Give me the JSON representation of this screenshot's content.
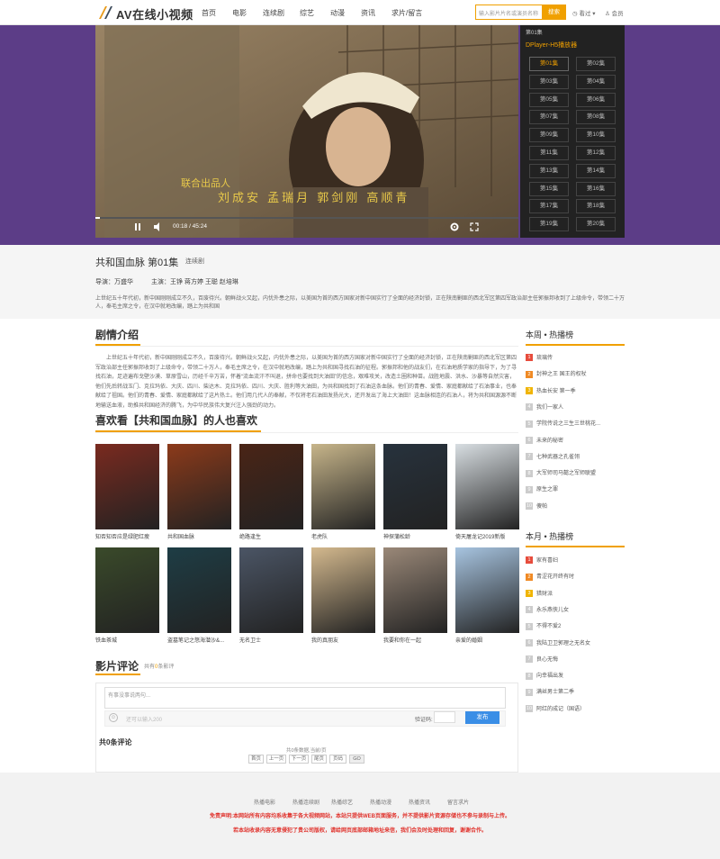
{
  "header": {
    "logo_text": "AV在线小视频",
    "nav": [
      "首页",
      "电影",
      "连续剧",
      "综艺",
      "动漫",
      "资讯",
      "求片/留言"
    ],
    "search_placeholder": "输入影片片名或演员名称",
    "search_button": "搜索",
    "watch_history": "看过",
    "member": "会员"
  },
  "player": {
    "credits_line1": "联合出品人",
    "credits_line2": "刘成安  孟瑞月  郭剑刚  高顺青",
    "time": "00:18 / 45:24",
    "progress": 0.0066
  },
  "episodes": {
    "header": "第01集",
    "source": "DPlayer-H5播放器",
    "items": [
      "第01集",
      "第02集",
      "第03集",
      "第04集",
      "第05集",
      "第06集",
      "第07集",
      "第08集",
      "第09集",
      "第10集",
      "第11集",
      "第12集",
      "第13集",
      "第14集",
      "第15集",
      "第16集",
      "第17集",
      "第18集",
      "第19集",
      "第20集"
    ],
    "active": "第01集"
  },
  "info": {
    "title": "共和国血脉 第01集",
    "tag": "连续剧",
    "director_label": "导演：",
    "director": "万盛华",
    "cast_label": "主演：",
    "cast": "王铮 蒋方婷 王聪 赵培琳",
    "synopsis": "上世纪五十年代初，新中国刚刚成立不久，百废待兴。朝鲜战火又起，内忧外患之际，以美国为首的西方国家对新中国实行了全面的经济封锁，正在陕南剿匪的西北军区第四军政治部主任郭振邦收到了上级命令，带领二十万人，奉毛主席之令，在汉中就地改编，踏上为共和国"
  },
  "intro": {
    "title": "剧情介绍",
    "text": "上世纪五十年代初，新中国刚刚成立不久，百废待兴。朝鲜战火又起，内忧外患之际，以美国为首的西方国家对新中国实行了全面的经济封锁，正在陕南剿匪的西北军区第四军政治部主任郭振邦收到了上级命令，带领二十万人，奉毛主席之令，在汉中就地改编，踏上为共和国寻找石油的征程。郭振邦和他的战友们，在石油地质学家的指导下，为了寻找石油，足迹遍布戈壁沙漠、草原雪山，历经千辛万苦，怀着“流血流汗不叫退，拼命也要找到大油田”的信念，艰难攻关，改造土圈和种苗。战胜地震、洪水、沙暴等自然灾害，他们先后转战玉门、克拉玛依、大庆、四川、柴达木、克拉玛依、四川、大庆、胜利等大油田，为共和国找到了石油这条血脉。他们的青春、爱情、家庭都献给了石油事业，也奉献给了祖国。他们的青春、爱情、家庭都献给了这片热土。他们用几代人的奉献，不仅将老石油田发扬光大，还开发出了海上大油田！这血脉相连的石油人，将为共和国源源不断地输送血液，助推共和国经济的腾飞，为中华民族伟大复兴注入强劲的动力。"
  },
  "related": {
    "title": "喜欢看【共和国血脉】的人也喜欢",
    "items": [
      {
        "title": "知否知否应是绿肥红瘦",
        "color": "#7a2a1f"
      },
      {
        "title": "共和国血脉",
        "color": "#8c3a1a"
      },
      {
        "title": "绝路逢生",
        "color": "#4a2416"
      },
      {
        "title": "老虎队",
        "color": "#c7b58a"
      },
      {
        "title": "神探蒲松龄",
        "color": "#27323d"
      },
      {
        "title": "倚天屠龙记2019新版",
        "color": "#d8dee2"
      },
      {
        "title": "铁血茶城",
        "color": "#3a4a2a"
      },
      {
        "title": "盗墓笔记之怒海潜沙&...",
        "color": "#1e3d45"
      },
      {
        "title": "无名卫士",
        "color": "#4b5565"
      },
      {
        "title": "我的真朋友",
        "color": "#d4b98e"
      },
      {
        "title": "我要和你在一起",
        "color": "#9a8878"
      },
      {
        "title": "亲爱的婚姻",
        "color": "#a7c4e0"
      }
    ]
  },
  "comments": {
    "title": "影片评论",
    "summary_prefix": "共有",
    "summary_count": "0",
    "summary_suffix": "条影评",
    "placeholder": "有事没事说两句...",
    "input_hint": "还可以输入200",
    "vcode_label": "验证码:",
    "submit": "发布",
    "count_label": "共0条评论",
    "stats": "共0条数据,当前/页",
    "pager": [
      "首页",
      "上一页",
      "下一页",
      "尾页",
      "页码",
      "GO"
    ]
  },
  "ranking": {
    "weekly_title": "本周 • 热播榜",
    "weekly": [
      "琉璃传",
      "封神之王 国王的权杖",
      "热血长安 第一季",
      "我们一家人",
      "学院传说之三生三世桃花...",
      "未来的秘密",
      "七种武器之孔雀翎",
      "大军师司马懿之军师联盟",
      "原生之罪",
      "傻帕"
    ],
    "monthly_title": "本月 • 热播榜",
    "monthly": [
      "家有喜妇",
      "青涩花开终有时",
      "猎财派",
      "永乐燕侠儿女",
      "不得不爱2",
      "我陆卫卫郭理之无名女",
      "良心无悔",
      "向幸福出发",
      "满丝男士第二季",
      "阿红的成记（国语）"
    ]
  },
  "footer": {
    "links": [
      "热播电影",
      "热播连续剧",
      "热播综艺",
      "热播动漫",
      "热播资讯",
      "留言求片"
    ],
    "note1": "免责声明:本网站所有内容均系收集于各大视频网站，本站只提供WEB页面服务，并不提供影片资源存储也不参与录制与上传。",
    "note2": "若本站收录内容无意侵犯了贵公司版权，请给网页底部邮箱地址来信，我们会及时处理和回复，谢谢合作。"
  }
}
